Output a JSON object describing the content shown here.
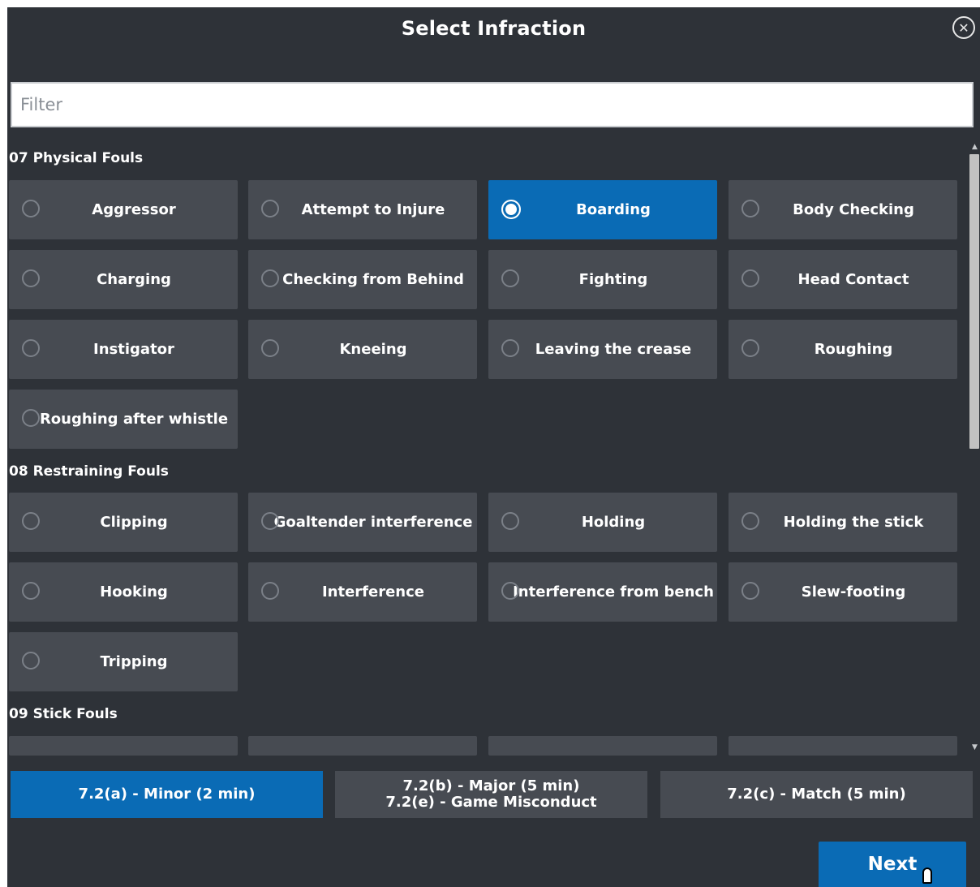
{
  "dialog": {
    "title": "Select Infraction",
    "close_icon": "close-icon"
  },
  "filter": {
    "placeholder": "Filter",
    "value": ""
  },
  "categories": [
    {
      "label": "07 Physical Fouls",
      "options": [
        {
          "label": "Aggressor",
          "selected": false
        },
        {
          "label": "Attempt to Injure",
          "selected": false
        },
        {
          "label": "Boarding",
          "selected": true
        },
        {
          "label": "Body Checking",
          "selected": false
        },
        {
          "label": "Charging",
          "selected": false
        },
        {
          "label": "Checking from Behind",
          "selected": false
        },
        {
          "label": "Fighting",
          "selected": false
        },
        {
          "label": "Head Contact",
          "selected": false
        },
        {
          "label": "Instigator",
          "selected": false
        },
        {
          "label": "Kneeing",
          "selected": false
        },
        {
          "label": "Leaving the crease",
          "selected": false
        },
        {
          "label": "Roughing",
          "selected": false
        },
        {
          "label": "Roughing after whistle",
          "selected": false
        }
      ]
    },
    {
      "label": "08 Restraining Fouls",
      "options": [
        {
          "label": "Clipping",
          "selected": false
        },
        {
          "label": "Goaltender interference",
          "selected": false
        },
        {
          "label": "Holding",
          "selected": false
        },
        {
          "label": "Holding the stick",
          "selected": false
        },
        {
          "label": "Hooking",
          "selected": false
        },
        {
          "label": "Interference",
          "selected": false
        },
        {
          "label": "Interference from bench",
          "selected": false
        },
        {
          "label": "Slew-footing",
          "selected": false
        },
        {
          "label": "Tripping",
          "selected": false
        }
      ]
    },
    {
      "label": "09 Stick Fouls",
      "options": []
    }
  ],
  "severity": [
    {
      "line1": "7.2(a) - Minor (2 min)",
      "line2": "",
      "active": true
    },
    {
      "line1": "7.2(b) - Major (5 min)",
      "line2": "7.2(e) - Game Misconduct",
      "active": false
    },
    {
      "line1": "7.2(c) - Match (5 min)",
      "line2": "",
      "active": false
    }
  ],
  "footer": {
    "next_label": "Next"
  },
  "colors": {
    "background": "#2e3238",
    "tile": "#474b52",
    "accent": "#0a6bb5"
  }
}
